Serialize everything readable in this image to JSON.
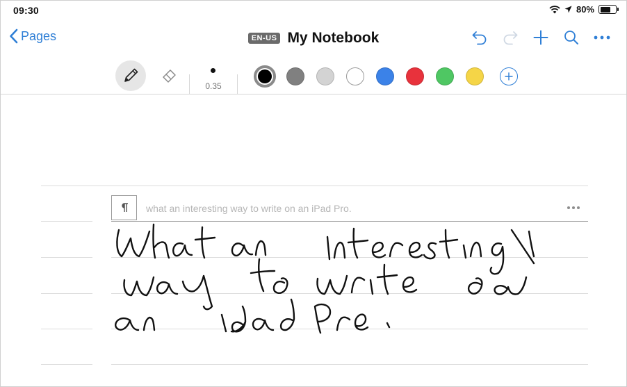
{
  "status_bar": {
    "time": "09:30",
    "battery": "80%",
    "battery_level": 0.8
  },
  "nav": {
    "back_label": "Pages",
    "language": "EN-US",
    "title": "My Notebook"
  },
  "toolbar": {
    "pen_size": "0.35",
    "colors": [
      "#000000",
      "#808080",
      "#d3d3d3",
      "#ffffff",
      "#3b82e8",
      "#e8323c",
      "#4fc763",
      "#f5d547"
    ],
    "selected_color": "#000000"
  },
  "note": {
    "recognized_text": "what an interesting way to write on an iPad Pro."
  },
  "colors": {
    "accent": "#2f7fd6"
  }
}
